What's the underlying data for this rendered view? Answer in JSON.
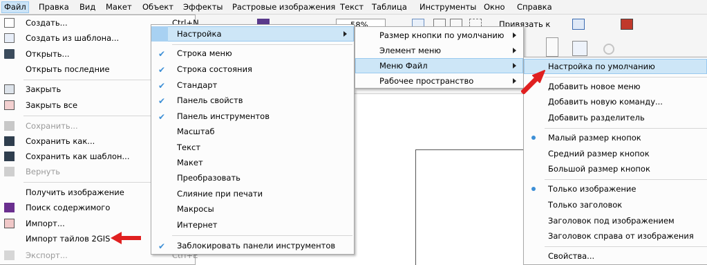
{
  "menubar": [
    "Файл",
    "Правка",
    "Вид",
    "Макет",
    "Объект",
    "Эффекты",
    "Растровые изображения",
    "Текст",
    "Таблица",
    "Инструменты",
    "Окно",
    "Справка"
  ],
  "toolbar": {
    "zoom_value": "58%",
    "snap_label": "Привязать к"
  },
  "file_menu": [
    {
      "label": "Создать...",
      "shortcut": "Ctrl+N"
    },
    {
      "label": "Создать из шаблона..."
    },
    {
      "label": "Открыть..."
    },
    {
      "label": "Открыть последние"
    },
    {
      "label": "Закрыть"
    },
    {
      "label": "Закрыть все"
    },
    {
      "label": "Сохранить...",
      "disabled": true
    },
    {
      "label": "Сохранить как..."
    },
    {
      "label": "Сохранить как шаблон..."
    },
    {
      "label": "Вернуть",
      "disabled": true
    },
    {
      "label": "Получить изображение"
    },
    {
      "label": "Поиск содержимого"
    },
    {
      "label": "Импорт..."
    },
    {
      "label": "Импорт тайлов 2GIS"
    },
    {
      "label": "Экспорт...",
      "shortcut": "Ctrl+E",
      "disabled": true
    }
  ],
  "customize_menu": {
    "header": "Настройка",
    "items": [
      {
        "label": "Строка меню",
        "checked": true
      },
      {
        "label": "Строка состояния",
        "checked": true
      },
      {
        "label": "Стандарт",
        "checked": true
      },
      {
        "label": "Панель свойств",
        "checked": true
      },
      {
        "label": "Панель инструментов",
        "checked": true
      },
      {
        "label": "Масштаб",
        "checked": false
      },
      {
        "label": "Текст",
        "checked": false
      },
      {
        "label": "Макет",
        "checked": false
      },
      {
        "label": "Преобразовать",
        "checked": false
      },
      {
        "label": "Слияние при печати",
        "checked": false
      },
      {
        "label": "Макросы",
        "checked": false
      },
      {
        "label": "Интернет",
        "checked": false
      }
    ],
    "lock": "Заблокировать панели инструментов"
  },
  "settings_menu": [
    "Размер кнопки по умолчанию",
    "Элемент меню",
    "Меню Файл",
    "Рабочее пространство"
  ],
  "file_menu_sub": {
    "default": "Настройка по умолчанию",
    "add": [
      "Добавить новое меню",
      "Добавить новую команду...",
      "Добавить разделитель"
    ],
    "sizes": [
      "Малый размер кнопок",
      "Средний размер кнопок",
      "Большой размер кнопок"
    ],
    "modes": [
      "Только изображение",
      "Только заголовок",
      "Заголовок под изображением",
      "Заголовок справа от изображения"
    ],
    "props": "Свойства..."
  },
  "colors": {
    "highlight": "#cde6f7",
    "check": "#3d8fd6",
    "annotation_arrow": "#e02020"
  }
}
